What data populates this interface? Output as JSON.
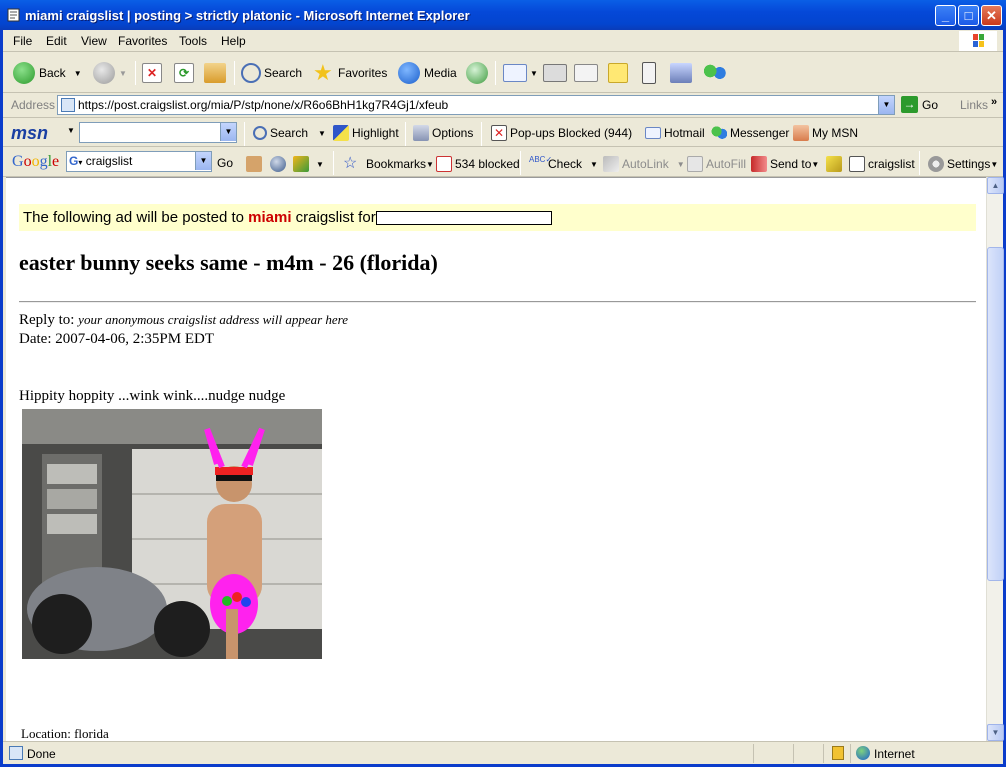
{
  "window": {
    "title": "miami craigslist | posting > strictly platonic - Microsoft Internet Explorer"
  },
  "menu": [
    "File",
    "Edit",
    "View",
    "Favorites",
    "Tools",
    "Help"
  ],
  "toolbar": {
    "back": "Back",
    "search": "Search",
    "favorites": "Favorites",
    "media": "Media"
  },
  "address": {
    "label": "Address",
    "url": "https://post.craigslist.org/mia/P/stp/none/x/R6o6BhH1kg7R4Gj1/xfeub",
    "go": "Go",
    "links": "Links"
  },
  "msnbar": {
    "logo": "msn",
    "search": "Search",
    "highlight": "Highlight",
    "options": "Options",
    "popups": "Pop-ups Blocked (944)",
    "hotmail": "Hotmail",
    "messenger": "Messenger",
    "mymsn": "My MSN"
  },
  "googlebar": {
    "logo": "Google",
    "query": "craigslist",
    "go": "Go",
    "bookmarks": "Bookmarks",
    "blocked": "534 blocked",
    "check": "Check",
    "autolink": "AutoLink",
    "autofill": "AutoFill",
    "sendto": "Send to",
    "craigslist": "craigslist",
    "settings": "Settings"
  },
  "page": {
    "notice_prefix": "The following ad will be posted to",
    "notice_city": "miami",
    "notice_suffix": "craigslist for",
    "title": "easter bunny seeks same - m4m - 26 (florida)",
    "reply_label": "Reply to:",
    "reply_value": "your anonymous craigslist address will appear here",
    "date": "Date: 2007-04-06, 2:35PM EDT",
    "body": "Hippity hoppity ...wink wink....nudge nudge",
    "location": "Location: florida"
  },
  "status": {
    "text": "Done",
    "zone": "Internet"
  },
  "colors": {
    "titlebar": "#0548d8",
    "notice_bg": "#ffffcc",
    "city": "#cc0000"
  }
}
